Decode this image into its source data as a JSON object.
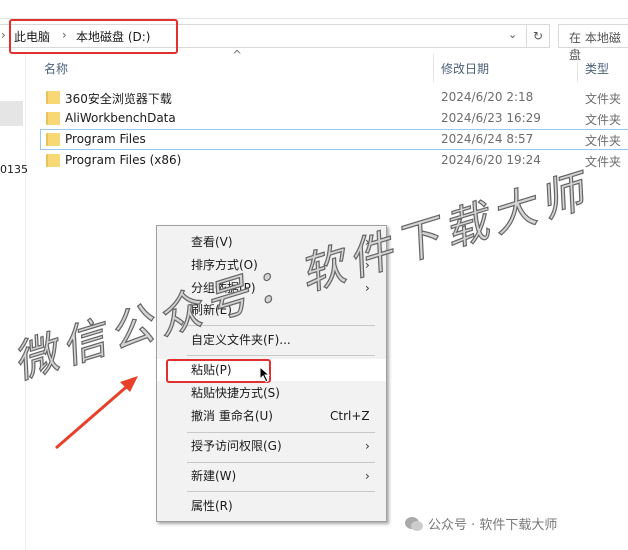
{
  "breadcrumb": {
    "items": [
      "此电脑",
      "本地磁盘 (D:)"
    ],
    "separator": "›"
  },
  "search": {
    "placeholder": "在 本地磁盘"
  },
  "columns": {
    "name": "名称",
    "date": "修改日期",
    "type": "类型"
  },
  "files": [
    {
      "name": "360安全浏览器下载",
      "date": "2024/6/20 2:18",
      "type": "文件夹"
    },
    {
      "name": "AliWorkbenchData",
      "date": "2024/6/23 16:29",
      "type": "文件夹"
    },
    {
      "name": "Program Files",
      "date": "2024/6/24 8:57",
      "type": "文件夹"
    },
    {
      "name": "Program Files (x86)",
      "date": "2024/6/20 19:24",
      "type": "文件夹"
    }
  ],
  "sidebar": {
    "partial_text": "0135"
  },
  "context_menu": {
    "items": [
      {
        "label": "查看(V)"
      },
      {
        "label": "排序方式(O)"
      },
      {
        "label": "分组依据(P)"
      },
      {
        "label": "刷新(E)"
      },
      {
        "label": "自定义文件夹(F)..."
      },
      {
        "label": "粘贴(P)"
      },
      {
        "label": "粘贴快捷方式(S)"
      },
      {
        "label": "撤消 重命名(U)",
        "shortcut": "Ctrl+Z"
      },
      {
        "label": "授予访问权限(G)"
      },
      {
        "label": "新建(W)"
      },
      {
        "label": "属性(R)"
      }
    ]
  },
  "watermark": "微信公众号：软件下载大师",
  "credit": "公众号 · 软件下载大师",
  "colors": {
    "highlight": "#e03030",
    "folder": "#f8d775"
  }
}
